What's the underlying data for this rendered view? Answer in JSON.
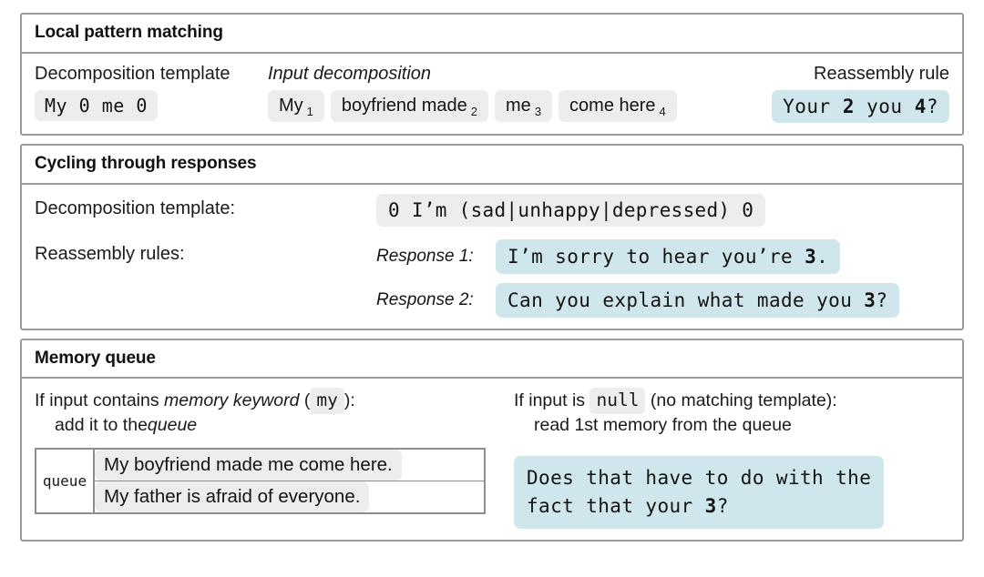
{
  "panels": [
    {
      "title": "Local pattern matching",
      "labels": {
        "decomposition_template": "Decomposition template",
        "input_decomposition": "Input decomposition",
        "reassembly_rule": "Reassembly rule"
      },
      "decomposition_template": "My 0 me 0",
      "input_decomposition": [
        {
          "text": "My",
          "index": "1"
        },
        {
          "text": "boyfriend made",
          "index": "2"
        },
        {
          "text": "me",
          "index": "3"
        },
        {
          "text": "come here",
          "index": "4"
        }
      ],
      "reassembly_rule": {
        "part1": "Your ",
        "ref1": "2",
        "part2": " you ",
        "ref2": "4",
        "part3": "?"
      }
    },
    {
      "title": "Cycling through responses",
      "labels": {
        "decomposition_template": "Decomposition template:",
        "reassembly_rules": "Reassembly rules:"
      },
      "decomposition_template": "0 I’m (sad|unhappy|depressed) 0",
      "responses": [
        {
          "label": "Response 1:",
          "part1": "I’m sorry to hear you’re ",
          "ref": "3",
          "part2": "."
        },
        {
          "label": "Response 2:",
          "part1": "Can you explain what made you ",
          "ref": "3",
          "part2": "?"
        }
      ]
    },
    {
      "title": "Memory queue",
      "left_note": {
        "line1_a": "If input contains ",
        "line1_em": "memory keyword",
        "line1_b": " (",
        "line1_code": "my",
        "line1_c": "):",
        "line2_a": "add it to the ",
        "line2_em": "queue"
      },
      "right_note": {
        "line1_a": "If input is ",
        "line1_code": "null",
        "line1_b": " (no matching template):",
        "line2": "read 1st memory from the queue"
      },
      "queue_label": "queue",
      "queue_items": [
        "My boyfriend made me come here.",
        "My father is afraid of everyone."
      ],
      "output": {
        "line1": "Does that have to do with the",
        "line2_a": "fact that your ",
        "line2_ref": "3",
        "line2_b": "?"
      }
    }
  ],
  "colors": {
    "chip_gray": "#ededed",
    "chip_teal": "#cfe7ec",
    "border": "#9a9a9a",
    "text": "#141414"
  }
}
